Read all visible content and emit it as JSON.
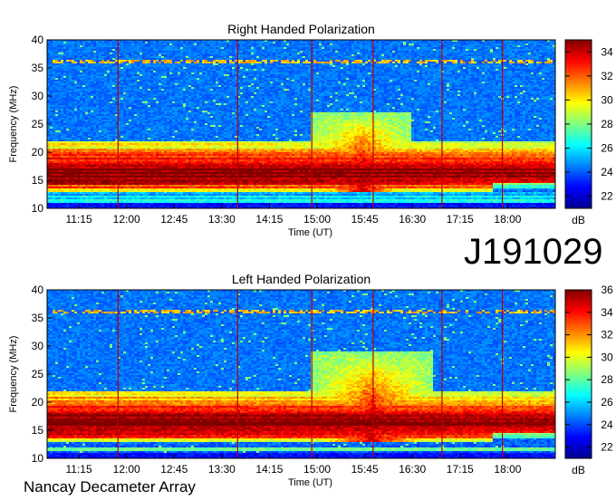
{
  "figure": {
    "observation_id": "J191029",
    "instrument": "Nancay Decameter Array"
  },
  "chart_data": [
    {
      "type": "heatmap",
      "title": "Right Handed Polarization",
      "xlabel": "Time (UT)",
      "ylabel": "Frequency (MHz)",
      "x_ticks": [
        "11:15",
        "12:00",
        "12:45",
        "13:30",
        "14:15",
        "15:00",
        "15:45",
        "16:30",
        "17:15",
        "18:00"
      ],
      "y_ticks": [
        10,
        15,
        20,
        25,
        30,
        35,
        40
      ],
      "ylim": [
        10,
        40
      ],
      "xlim": [
        "10:45",
        "18:45"
      ],
      "colorbar": {
        "label": "dB",
        "range": [
          21,
          35
        ],
        "ticks": [
          22,
          24,
          26,
          28,
          30,
          32,
          34
        ]
      },
      "vertical_markers_ut": [
        "11:52",
        "13:45",
        "14:55",
        "15:53",
        "16:58",
        "17:55"
      ],
      "features": {
        "emission_band_mhz": [
          13,
          22
        ],
        "burst_window_ut": [
          "14:55",
          "16:30"
        ],
        "burst_peak_freq_mhz": 25
      }
    },
    {
      "type": "heatmap",
      "title": "Left Handed Polarization",
      "xlabel": "Time (UT)",
      "ylabel": "Frequency (MHz)",
      "x_ticks": [
        "11:15",
        "12:00",
        "12:45",
        "13:30",
        "14:15",
        "15:00",
        "15:45",
        "16:30",
        "17:15",
        "18:00"
      ],
      "y_ticks": [
        10,
        15,
        20,
        25,
        30,
        35,
        40
      ],
      "ylim": [
        10,
        40
      ],
      "xlim": [
        "10:45",
        "18:45"
      ],
      "colorbar": {
        "label": "dB",
        "range": [
          21,
          36
        ],
        "ticks": [
          22,
          24,
          26,
          28,
          30,
          32,
          34,
          36
        ]
      },
      "vertical_markers_ut": [
        "11:52",
        "13:45",
        "14:55",
        "15:53",
        "16:58",
        "17:55"
      ],
      "features": {
        "emission_band_mhz": [
          13,
          22
        ],
        "burst_window_ut": [
          "14:55",
          "16:50"
        ],
        "burst_peak_freq_mhz": 27
      }
    }
  ]
}
